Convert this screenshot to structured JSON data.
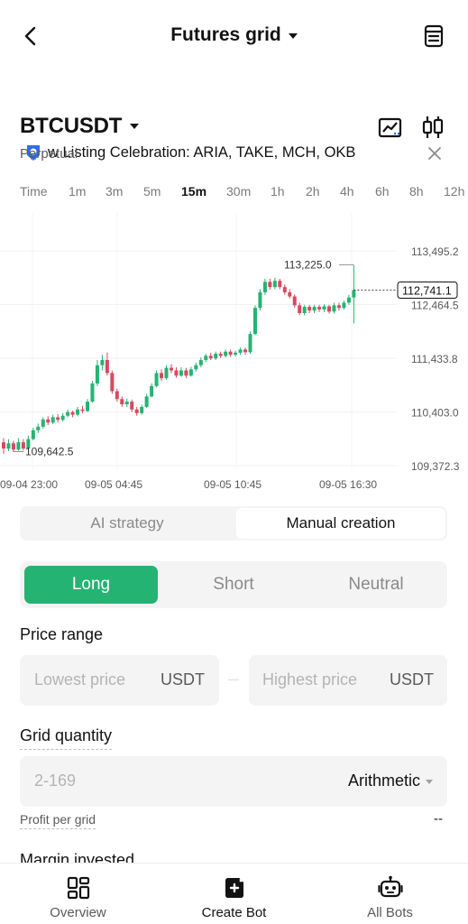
{
  "header": {
    "title": "Futures grid"
  },
  "banner": {
    "text": "w Listing Celebration: ARIA, TAKE, MCH, OKB"
  },
  "instrument": {
    "symbol": "BTCUSDT",
    "type": "Perpetual"
  },
  "timeframes": [
    "Time",
    "1m",
    "3m",
    "5m",
    "15m",
    "30m",
    "1h",
    "2h",
    "4h",
    "6h",
    "8h",
    "12h"
  ],
  "active_timeframe": "15m",
  "chart_data": {
    "type": "candlestick",
    "y_ticks": [
      "113,495.2",
      "112,464.5",
      "111,433.8",
      "110,403.0",
      "109,372.3"
    ],
    "y_range": [
      109372.3,
      113495.2
    ],
    "x_ticks": [
      "09-04 23:00",
      "09-05 04:45",
      "09-05 10:45",
      "09-05 16:30"
    ],
    "high_label": "113,225.0",
    "low_label": "109,642.5",
    "last_price": "112,741.1",
    "colors": {
      "up": "#25b373",
      "down": "#d44b5e",
      "last_price_box": "#121212"
    },
    "candles": [
      {
        "o": 109820,
        "c": 109700,
        "h": 109900,
        "l": 109600
      },
      {
        "o": 109700,
        "c": 109800,
        "h": 109880,
        "l": 109650
      },
      {
        "o": 109800,
        "c": 109680,
        "h": 109850,
        "l": 109642.5
      },
      {
        "o": 109680,
        "c": 109820,
        "h": 109900,
        "l": 109660
      },
      {
        "o": 109820,
        "c": 109700,
        "h": 109880,
        "l": 109660
      },
      {
        "o": 109700,
        "c": 109880,
        "h": 109950,
        "l": 109680
      },
      {
        "o": 109880,
        "c": 110050,
        "h": 110100,
        "l": 109860
      },
      {
        "o": 110050,
        "c": 110120,
        "h": 110180,
        "l": 110000
      },
      {
        "o": 110120,
        "c": 110260,
        "h": 110300,
        "l": 110080
      },
      {
        "o": 110260,
        "c": 110200,
        "h": 110320,
        "l": 110150
      },
      {
        "o": 110200,
        "c": 110300,
        "h": 110350,
        "l": 110170
      },
      {
        "o": 110300,
        "c": 110250,
        "h": 110360,
        "l": 110200
      },
      {
        "o": 110250,
        "c": 110330,
        "h": 110380,
        "l": 110220
      },
      {
        "o": 110330,
        "c": 110400,
        "h": 110450,
        "l": 110300
      },
      {
        "o": 110400,
        "c": 110350,
        "h": 110430,
        "l": 110300
      },
      {
        "o": 110350,
        "c": 110450,
        "h": 110500,
        "l": 110320
      },
      {
        "o": 110450,
        "c": 110420,
        "h": 110520,
        "l": 110380
      },
      {
        "o": 110420,
        "c": 110600,
        "h": 110650,
        "l": 110400
      },
      {
        "o": 110600,
        "c": 110950,
        "h": 111000,
        "l": 110580
      },
      {
        "o": 110950,
        "c": 111300,
        "h": 111400,
        "l": 110900
      },
      {
        "o": 111300,
        "c": 111400,
        "h": 111500,
        "l": 111200
      },
      {
        "o": 111400,
        "c": 111150,
        "h": 111540,
        "l": 111100
      },
      {
        "o": 111150,
        "c": 110800,
        "h": 111200,
        "l": 110750
      },
      {
        "o": 110800,
        "c": 110650,
        "h": 110850,
        "l": 110600
      },
      {
        "o": 110650,
        "c": 110550,
        "h": 110700,
        "l": 110500
      },
      {
        "o": 110550,
        "c": 110600,
        "h": 110660,
        "l": 110500
      },
      {
        "o": 110600,
        "c": 110450,
        "h": 110640,
        "l": 110400
      },
      {
        "o": 110450,
        "c": 110380,
        "h": 110500,
        "l": 110330
      },
      {
        "o": 110380,
        "c": 110500,
        "h": 110540,
        "l": 110350
      },
      {
        "o": 110500,
        "c": 110700,
        "h": 110750,
        "l": 110480
      },
      {
        "o": 110700,
        "c": 110900,
        "h": 110950,
        "l": 110680
      },
      {
        "o": 110900,
        "c": 111150,
        "h": 111200,
        "l": 110880
      },
      {
        "o": 111150,
        "c": 111050,
        "h": 111220,
        "l": 111000
      },
      {
        "o": 111050,
        "c": 111250,
        "h": 111300,
        "l": 111020
      },
      {
        "o": 111250,
        "c": 111200,
        "h": 111320,
        "l": 111150
      },
      {
        "o": 111200,
        "c": 111100,
        "h": 111260,
        "l": 111060
      },
      {
        "o": 111100,
        "c": 111200,
        "h": 111260,
        "l": 111080
      },
      {
        "o": 111200,
        "c": 111100,
        "h": 111250,
        "l": 111050
      },
      {
        "o": 111100,
        "c": 111220,
        "h": 111270,
        "l": 111080
      },
      {
        "o": 111220,
        "c": 111300,
        "h": 111350,
        "l": 111180
      },
      {
        "o": 111300,
        "c": 111400,
        "h": 111450,
        "l": 111260
      },
      {
        "o": 111400,
        "c": 111480,
        "h": 111520,
        "l": 111360
      },
      {
        "o": 111480,
        "c": 111430,
        "h": 111540,
        "l": 111400
      },
      {
        "o": 111430,
        "c": 111520,
        "h": 111560,
        "l": 111400
      },
      {
        "o": 111520,
        "c": 111480,
        "h": 111560,
        "l": 111440
      },
      {
        "o": 111480,
        "c": 111560,
        "h": 111600,
        "l": 111450
      },
      {
        "o": 111560,
        "c": 111500,
        "h": 111600,
        "l": 111460
      },
      {
        "o": 111500,
        "c": 111540,
        "h": 111580,
        "l": 111470
      },
      {
        "o": 111540,
        "c": 111600,
        "h": 111640,
        "l": 111500
      },
      {
        "o": 111600,
        "c": 111550,
        "h": 111640,
        "l": 111500
      },
      {
        "o": 111550,
        "c": 111900,
        "h": 111950,
        "l": 111520
      },
      {
        "o": 111900,
        "c": 112400,
        "h": 112450,
        "l": 111880
      },
      {
        "o": 112400,
        "c": 112700,
        "h": 112760,
        "l": 112350
      },
      {
        "o": 112700,
        "c": 112900,
        "h": 112960,
        "l": 112650
      },
      {
        "o": 112900,
        "c": 112800,
        "h": 112960,
        "l": 112750
      },
      {
        "o": 112800,
        "c": 112920,
        "h": 112980,
        "l": 112760
      },
      {
        "o": 112920,
        "c": 112800,
        "h": 112960,
        "l": 112760
      },
      {
        "o": 112800,
        "c": 112700,
        "h": 112850,
        "l": 112650
      },
      {
        "o": 112700,
        "c": 112620,
        "h": 112760,
        "l": 112580
      },
      {
        "o": 112620,
        "c": 112450,
        "h": 112660,
        "l": 112400
      },
      {
        "o": 112450,
        "c": 112300,
        "h": 112500,
        "l": 112260
      },
      {
        "o": 112300,
        "c": 112420,
        "h": 112460,
        "l": 112260
      },
      {
        "o": 112420,
        "c": 112350,
        "h": 112460,
        "l": 112300
      },
      {
        "o": 112350,
        "c": 112420,
        "h": 112460,
        "l": 112300
      },
      {
        "o": 112420,
        "c": 112370,
        "h": 112460,
        "l": 112320
      },
      {
        "o": 112370,
        "c": 112430,
        "h": 112470,
        "l": 112320
      },
      {
        "o": 112430,
        "c": 112330,
        "h": 112460,
        "l": 112290
      },
      {
        "o": 112330,
        "c": 112450,
        "h": 112500,
        "l": 112290
      },
      {
        "o": 112450,
        "c": 112400,
        "h": 112500,
        "l": 112350
      },
      {
        "o": 112400,
        "c": 112500,
        "h": 112540,
        "l": 112370
      },
      {
        "o": 112500,
        "c": 112600,
        "h": 112650,
        "l": 112460
      },
      {
        "o": 112600,
        "c": 112741.1,
        "h": 113225.0,
        "l": 112100
      }
    ]
  },
  "strategy_tabs": {
    "ai": "AI strategy",
    "manual": "Manual creation",
    "selected": "Manual creation"
  },
  "direction": {
    "long": "Long",
    "short": "Short",
    "neutral": "Neutral",
    "selected": "Long"
  },
  "form": {
    "price_range_label": "Price range",
    "lowest_placeholder": "Lowest price",
    "highest_placeholder": "Highest price",
    "unit": "USDT",
    "grid_quantity_label": "Grid quantity",
    "grid_quantity_placeholder": "2-169",
    "grid_mode": "Arithmetic",
    "profit_per_grid_label": "Profit per grid",
    "profit_per_grid_value": "--",
    "margin_invested_label": "Margin invested"
  },
  "bottom_nav": {
    "overview": "Overview",
    "create_bot": "Create Bot",
    "all_bots": "All Bots",
    "active": "Create Bot"
  },
  "icons": {
    "back": "back-arrow-icon",
    "orders": "orders-icon",
    "banner": "trophy-badge-icon",
    "close": "close-icon",
    "chart": "chart-view-icon",
    "candles": "candlestick-icon",
    "overview": "overview-grid-icon",
    "create_bot": "create-bot-icon",
    "all_bots": "robot-icon"
  }
}
